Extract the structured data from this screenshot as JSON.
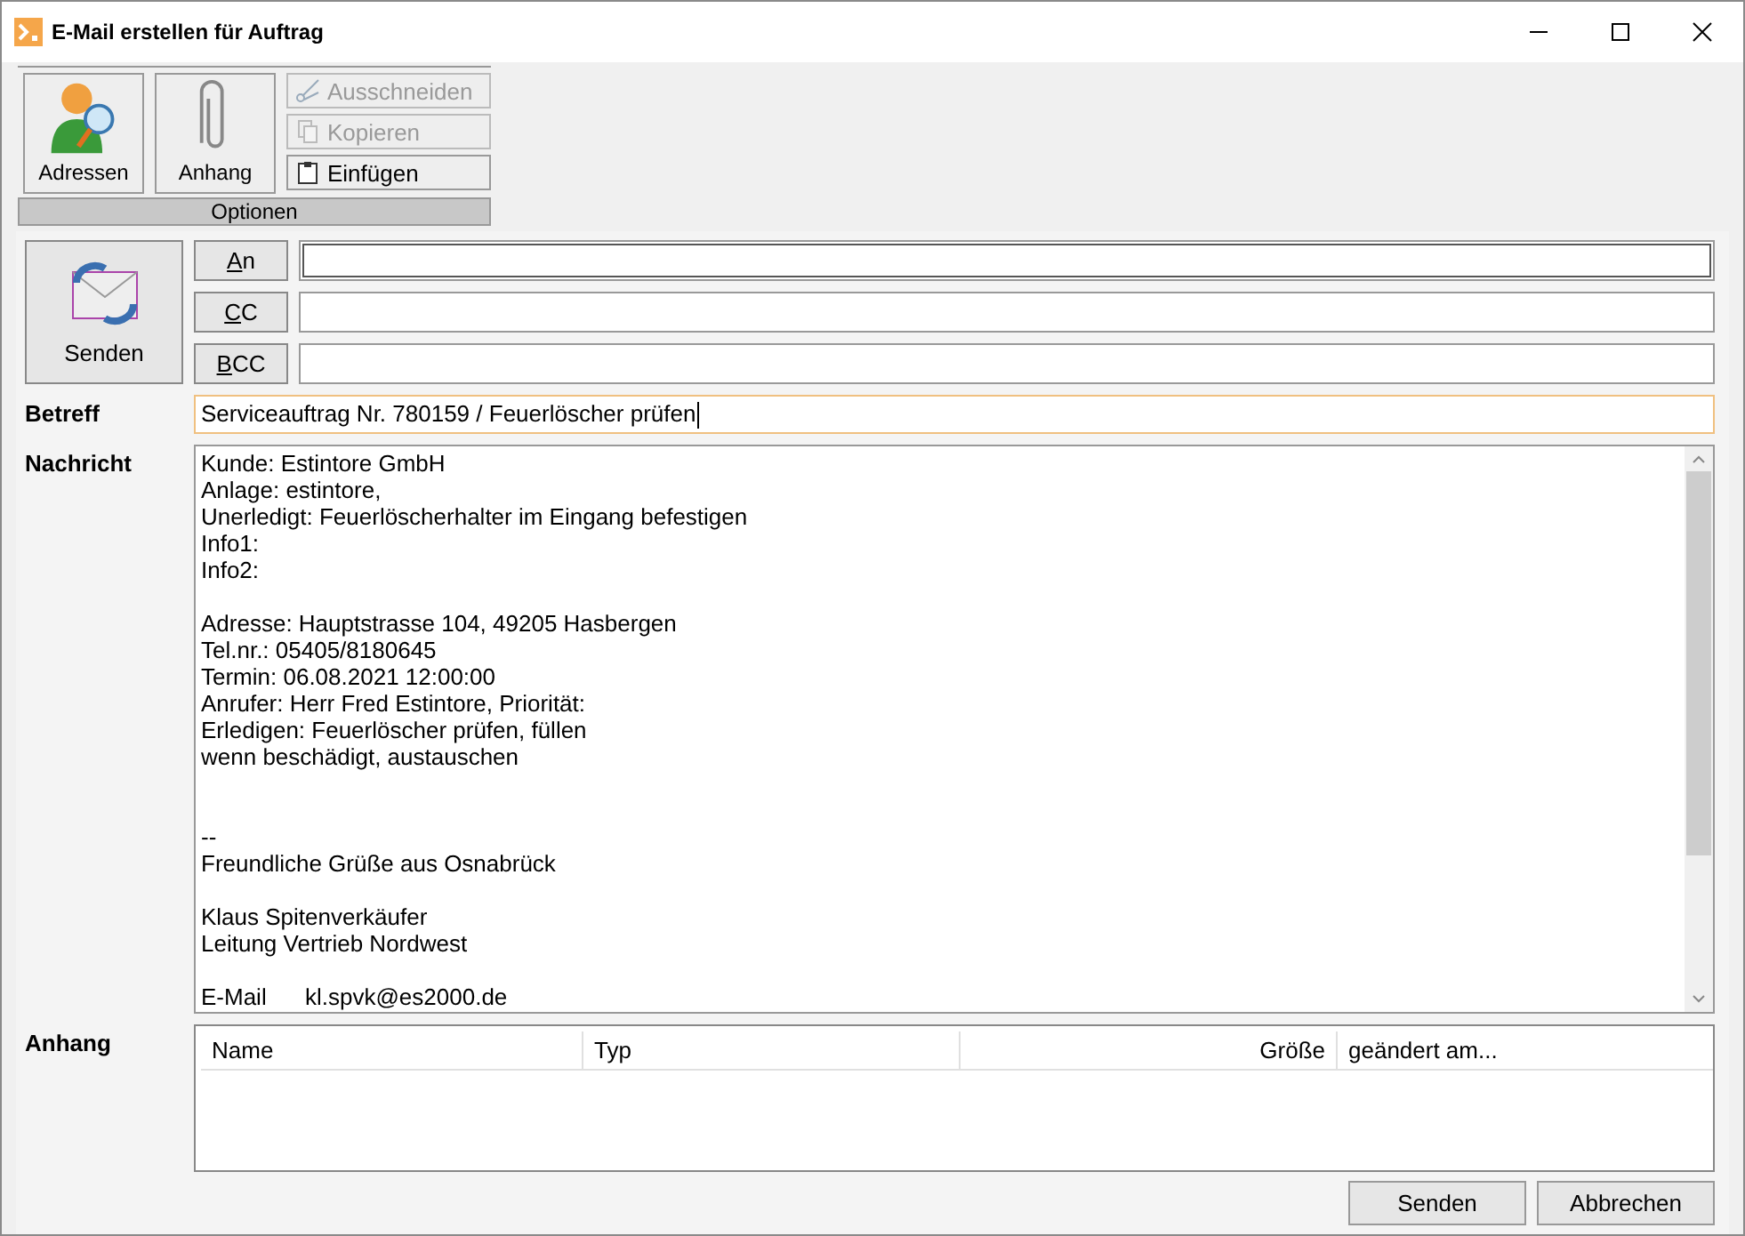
{
  "window": {
    "title": "E-Mail erstellen für Auftrag"
  },
  "toolbar": {
    "large_buttons": [
      {
        "label": "Adressen",
        "kind": "person"
      },
      {
        "label": "Anhang",
        "kind": "clip"
      }
    ],
    "small_buttons": [
      {
        "label": "Ausschneiden",
        "kind": "cut",
        "disabled": true
      },
      {
        "label": "Kopieren",
        "kind": "copy",
        "disabled": true
      },
      {
        "label": "Einfügen",
        "kind": "paste",
        "disabled": false
      }
    ],
    "group_label": "Optionen"
  },
  "send_button": {
    "label": "Senden"
  },
  "recipients": [
    {
      "label": "An",
      "focused": true
    },
    {
      "label": "CC",
      "focused": false
    },
    {
      "label": "BCC",
      "focused": false
    }
  ],
  "subject": {
    "label": "Betreff",
    "value": "Serviceauftrag Nr. 780159 / Feuerlöscher prüfen"
  },
  "message": {
    "label": "Nachricht",
    "value": "Kunde: Estintore GmbH\nAnlage: estintore,\nUnerledigt: Feuerlöscherhalter im Eingang befestigen\nInfo1:\nInfo2:\n\nAdresse: Hauptstrasse 104, 49205 Hasbergen\nTel.nr.: 05405/8180645\nTermin: 06.08.2021 12:00:00\nAnrufer: Herr Fred Estintore, Priorität:\nErledigen: Feuerlöscher prüfen, füllen\nwenn beschädigt, austauschen\n\n\n--\nFreundliche Grüße aus Osnabrück\n\nKlaus Spitenverkäufer\nLeitung Vertrieb Nordwest\n\nE-Mail      kl.spvk@es2000.de"
  },
  "attachments": {
    "label": "Anhang",
    "columns": [
      {
        "label": "Name",
        "right_aligned": false
      },
      {
        "label": "Typ",
        "right_aligned": false
      },
      {
        "label": "Größe",
        "right_aligned": true
      },
      {
        "label": "geändert am...",
        "right_aligned": false
      }
    ]
  },
  "buttons": [
    "Senden",
    "Abbrechen"
  ]
}
